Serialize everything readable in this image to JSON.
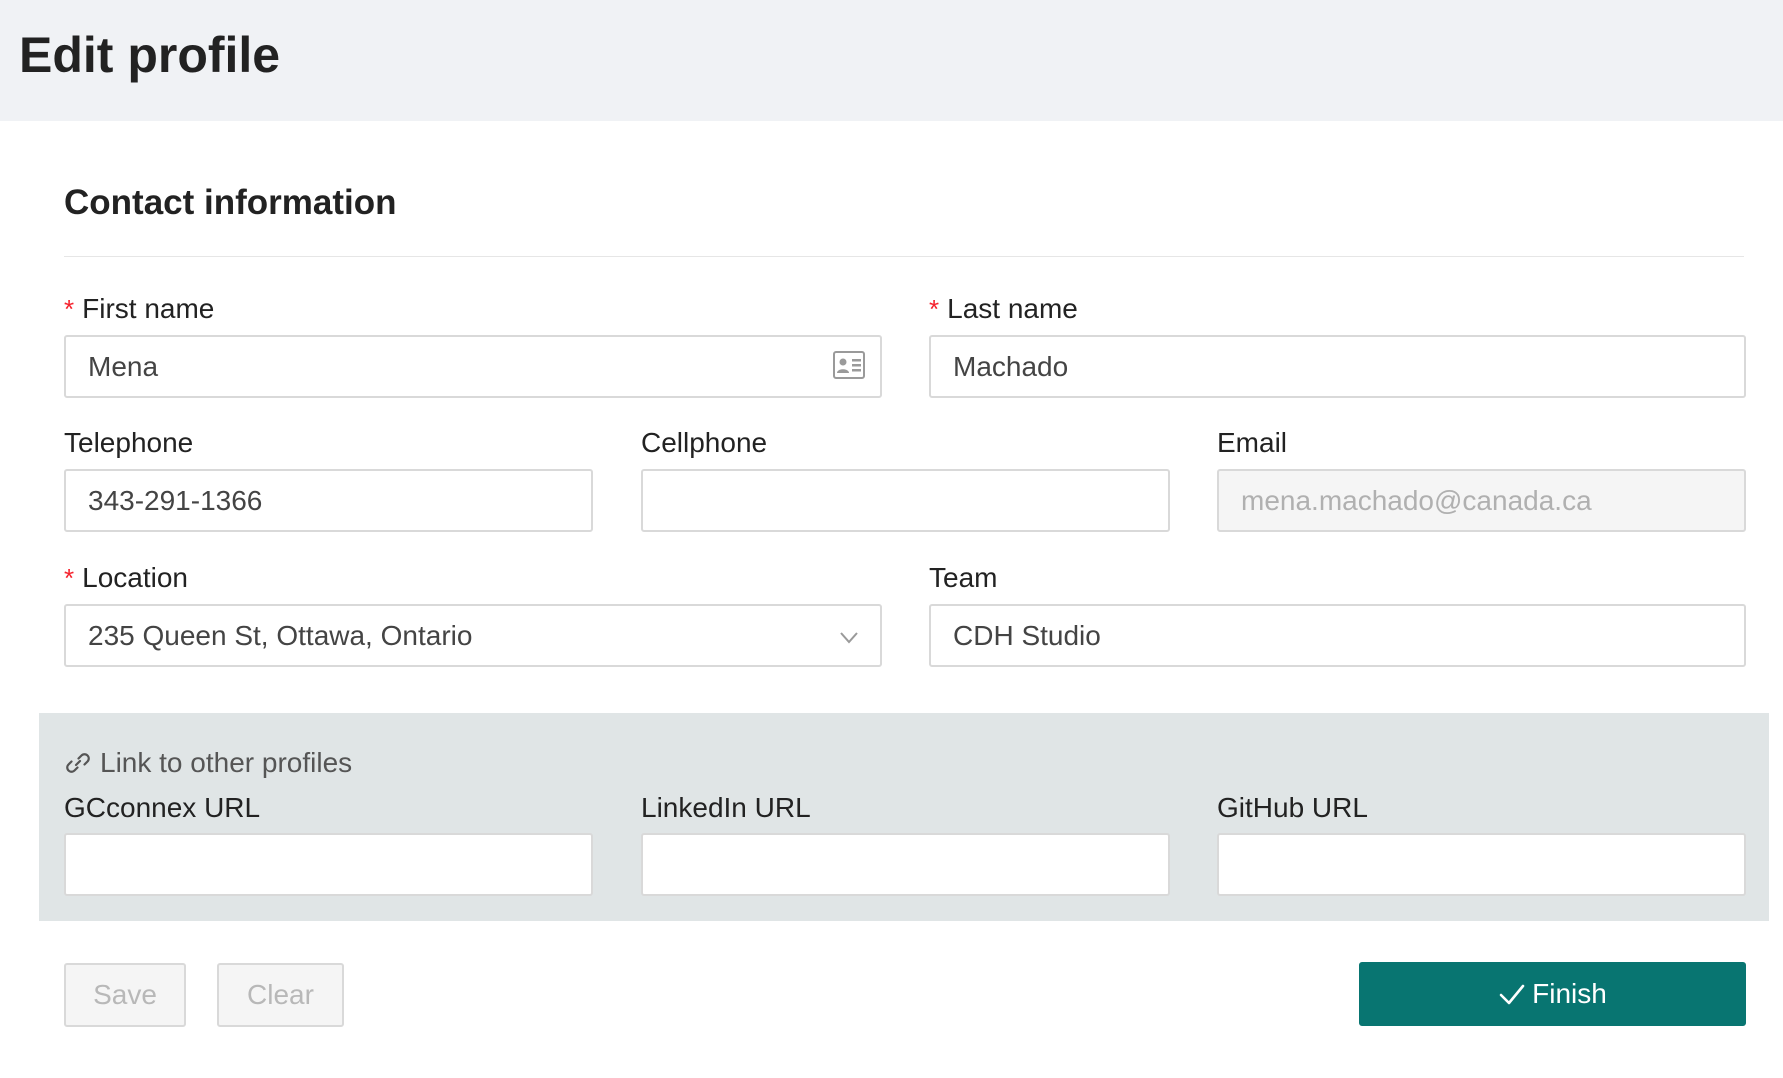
{
  "header": {
    "title": "Edit profile"
  },
  "contact": {
    "section_title": "Contact information",
    "first_name": {
      "label": "First name",
      "value": "Mena",
      "required": true
    },
    "last_name": {
      "label": "Last name",
      "value": "Machado",
      "required": true
    },
    "telephone": {
      "label": "Telephone",
      "value": "343-291-1366"
    },
    "cellphone": {
      "label": "Cellphone",
      "value": ""
    },
    "email": {
      "label": "Email",
      "value": "mena.machado@canada.ca",
      "disabled": true
    },
    "location": {
      "label": "Location",
      "value": "235 Queen St, Ottawa, Ontario",
      "required": true
    },
    "team": {
      "label": "Team",
      "value": "CDH Studio"
    }
  },
  "links": {
    "title": "Link to other profiles",
    "gcconnex": {
      "label": "GCconnex URL",
      "value": ""
    },
    "linkedin": {
      "label": "LinkedIn URL",
      "value": ""
    },
    "github": {
      "label": "GitHub URL",
      "value": ""
    }
  },
  "actions": {
    "save_label": "Save",
    "clear_label": "Clear",
    "finish_label": "Finish"
  },
  "icons": {
    "required_marker": "*",
    "first_name_suffix": "id-card-icon",
    "location_dropdown": "chevron-down-icon",
    "links_title": "link-icon",
    "finish": "check-icon"
  },
  "colors": {
    "primary": "#087571",
    "required": "#f5222d",
    "header_bg": "#f0f2f5",
    "links_panel_bg": "#e0e5e6",
    "disabled_bg": "#f5f5f5"
  }
}
